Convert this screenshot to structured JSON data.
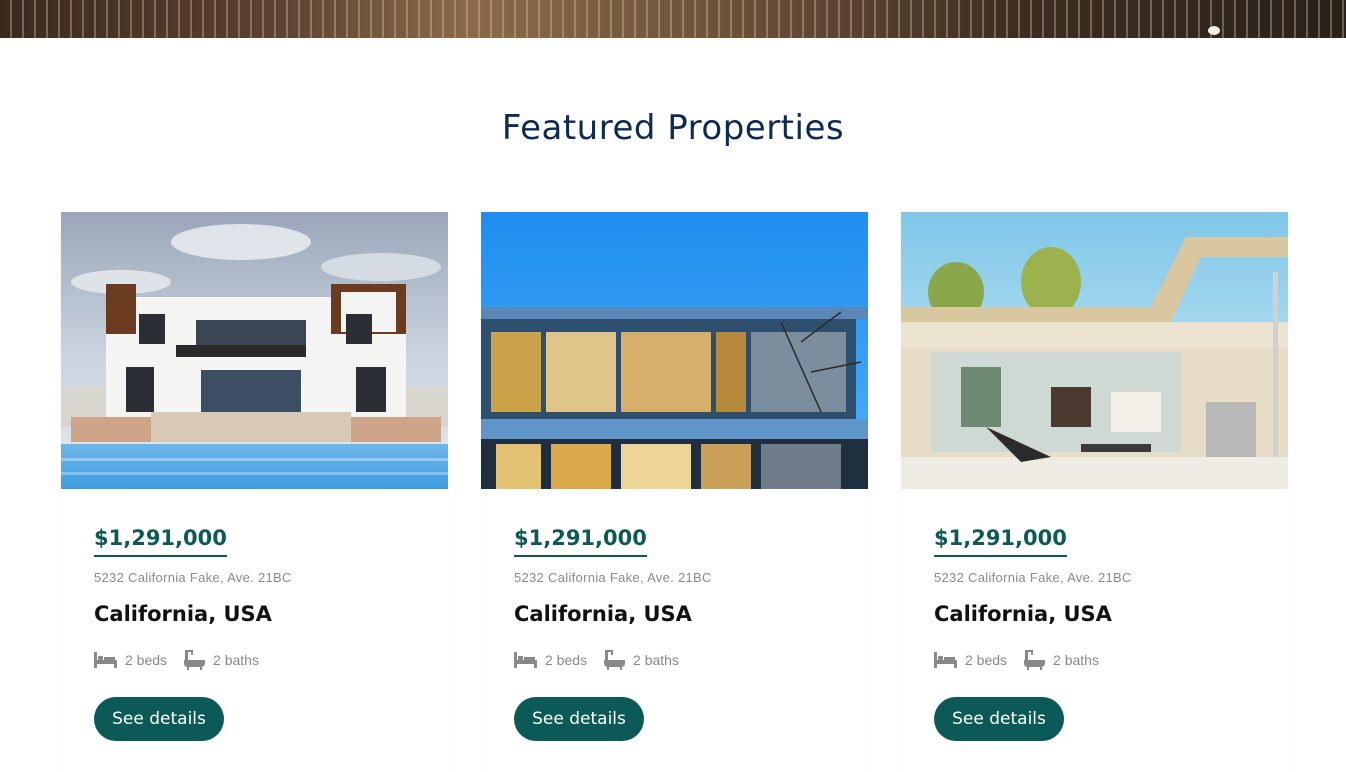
{
  "section": {
    "title": "Featured Properties"
  },
  "colors": {
    "accent": "#0b5a57",
    "title": "#0d2a52"
  },
  "properties": [
    {
      "image_icon": "modern-villa-pool-photo",
      "price": "$1,291,000",
      "address": "5232 California Fake, Ave. 21BC",
      "city": "California, USA",
      "beds": "2 beds",
      "baths": "2 baths",
      "button": "See details"
    },
    {
      "image_icon": "modern-house-night-photo",
      "price": "$1,291,000",
      "address": "5232 California Fake, Ave. 21BC",
      "city": "California, USA",
      "beds": "2 beds",
      "baths": "2 baths",
      "button": "See details"
    },
    {
      "image_icon": "glass-house-patio-photo",
      "price": "$1,291,000",
      "address": "5232 California Fake, Ave. 21BC",
      "city": "California, USA",
      "beds": "2 beds",
      "baths": "2 baths",
      "button": "See details"
    }
  ]
}
